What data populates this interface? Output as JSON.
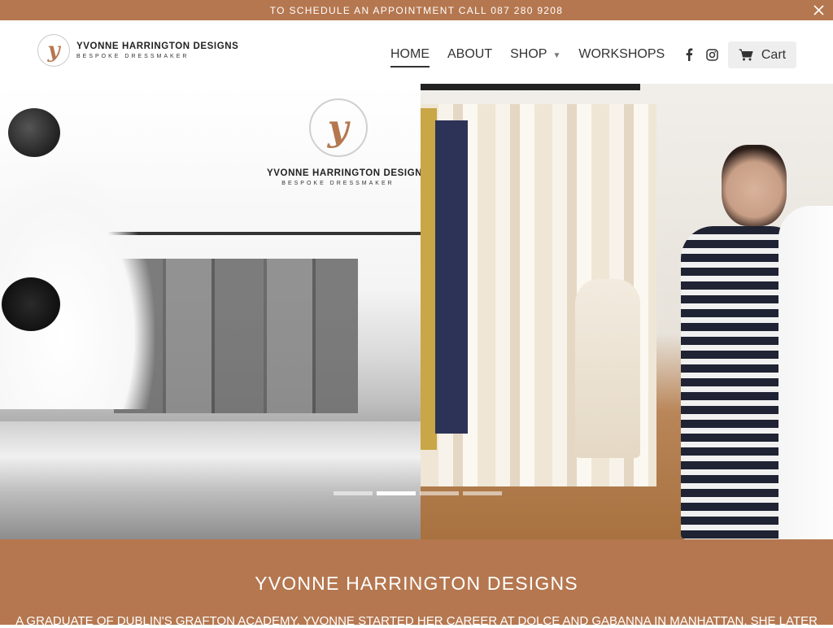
{
  "announcement": {
    "text": "TO SCHEDULE AN APPOINTMENT CALL 087 280 9208"
  },
  "header": {
    "logo": {
      "letter": "y",
      "name": "YVONNE HARRINGTON DESIGNS",
      "tagline": "BESPOKE DRESSMAKER"
    },
    "nav": [
      {
        "label": "HOME",
        "active": true
      },
      {
        "label": "ABOUT"
      },
      {
        "label": "SHOP",
        "has_dropdown": true
      },
      {
        "label": "WORKSHOPS"
      }
    ],
    "icons": [
      "facebook-icon",
      "instagram-icon",
      "mail-icon",
      "search-icon"
    ],
    "cart_label": "Cart"
  },
  "hero": {
    "overlay_logo": {
      "letter": "y",
      "name": "YVONNE HARRINGTON DESIGNS",
      "tagline": "BESPOKE DRESSMAKER"
    },
    "slides_count": 4,
    "active_slide": 2
  },
  "intro": {
    "title": "YVONNE HARRINGTON DESIGNS",
    "text": "A GRADUATE OF DUBLIN'S GRAFTON ACADEMY, YVONNE STARTED HER CAREER AT DOLCE AND GABANNA IN MANHATTAN. SHE LATER"
  },
  "colors": {
    "brand": "#b5774f",
    "text": "#333333"
  }
}
